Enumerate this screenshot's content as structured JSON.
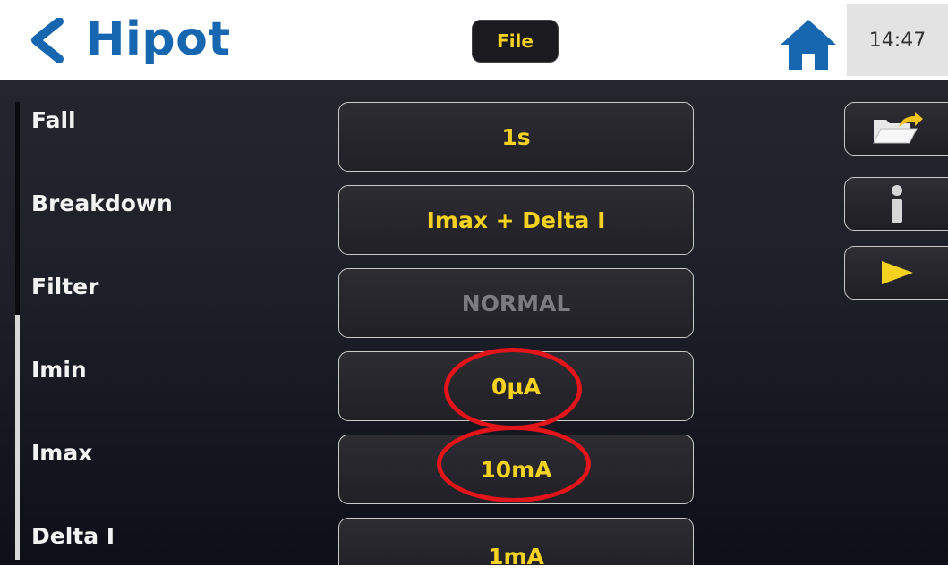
{
  "header": {
    "title": "Hipot",
    "file_label": "File",
    "clock": "14:47"
  },
  "params": [
    {
      "label": "Fall",
      "value": "1s",
      "enabled": true
    },
    {
      "label": "Breakdown",
      "value": "Imax + Delta I",
      "enabled": true
    },
    {
      "label": "Filter",
      "value": "NORMAL",
      "enabled": false
    },
    {
      "label": "Imin",
      "value": "0µA",
      "enabled": true
    },
    {
      "label": "Imax",
      "value": "10mA",
      "enabled": true
    },
    {
      "label": "Delta I",
      "value": "1mA",
      "enabled": true
    }
  ],
  "side_buttons": [
    "folder-export-icon",
    "info-icon",
    "play-icon"
  ],
  "colors": {
    "title_blue": "#1766b0",
    "value_yellow": "#f4d21f",
    "highlight_red": "#e3141a"
  }
}
